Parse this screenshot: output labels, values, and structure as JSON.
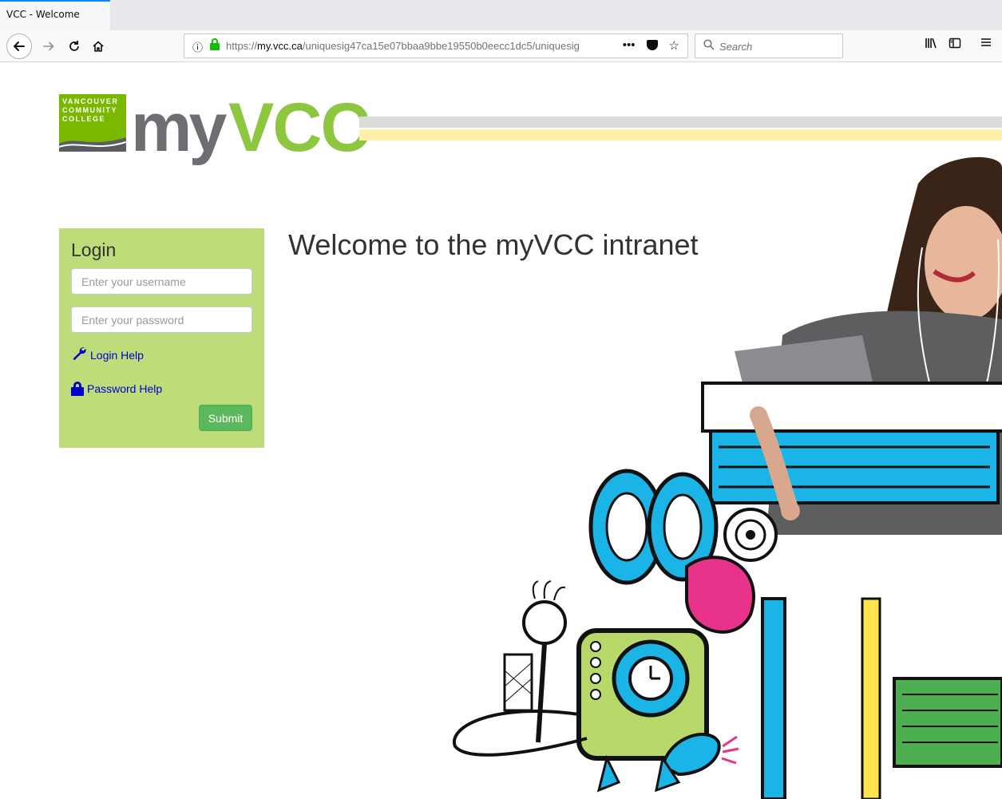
{
  "browser": {
    "tab_title": "VCC - Welcome",
    "url_host": "my.vcc.ca",
    "url_prefix": "https://",
    "url_path": "/uniquesig47ca15e07bbaa9bbe19550b0eecc1dc5/uniquesig",
    "search_placeholder": "Search",
    "icons": {
      "back": "back-arrow-icon",
      "forward": "forward-arrow-icon",
      "reload": "reload-icon",
      "home": "home-icon",
      "info": "info-icon",
      "lock": "lock-icon",
      "more": "more-icon",
      "pocket": "pocket-icon",
      "bookmark": "star-icon",
      "library": "library-icon",
      "sidebar": "sidebar-icon",
      "menu": "hamburger-menu-icon"
    }
  },
  "logo": {
    "line1": "VANCOUVER",
    "line2": "COMMUNITY",
    "line3": "COLLEGE",
    "my": "my",
    "vcc": "VCC"
  },
  "login": {
    "title": "Login",
    "username_placeholder": "Enter your username",
    "password_placeholder": "Enter your password",
    "login_help": "Login Help",
    "password_help": "Password Help",
    "submit": "Submit"
  },
  "welcome": {
    "heading": "Welcome to the myVCC intranet"
  },
  "colors": {
    "brand_green": "#8dc63f",
    "panel_green": "#bedd7a",
    "submit_green": "#5cb85c",
    "link_blue": "#0000cc"
  }
}
